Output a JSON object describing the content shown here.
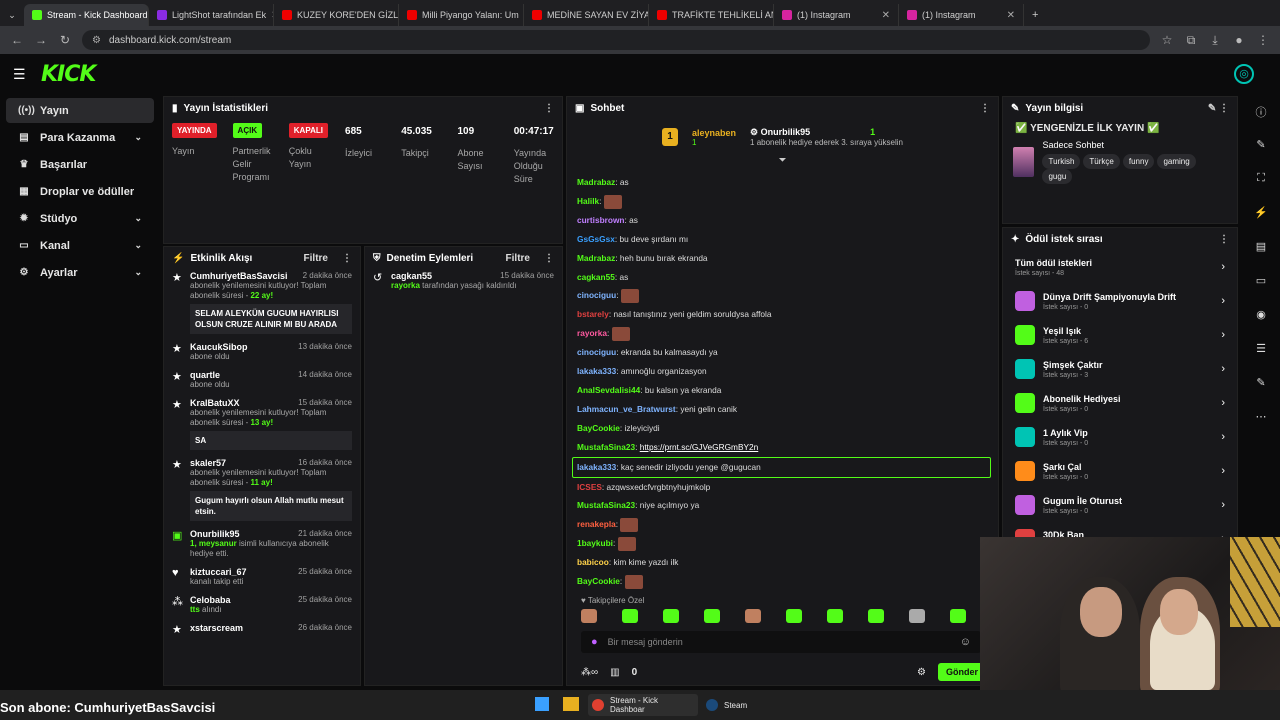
{
  "browser": {
    "tabs": [
      {
        "label": "Stream - Kick Dashboard",
        "color": "#53fc18",
        "active": true
      },
      {
        "label": "LightShot tarafından Ek",
        "color": "#8a2be2"
      },
      {
        "label": "KUZEY KORE'DEN GİZLİ",
        "color": "#e00"
      },
      {
        "label": "Milli Piyango Yalanı: Um",
        "color": "#e00"
      },
      {
        "label": "MEDİNE SAYAN EV ZİYA",
        "color": "#e00"
      },
      {
        "label": "TRAFİKTE TEHLİKELİ AN",
        "color": "#e00"
      },
      {
        "label": "(1) Instagram",
        "color": "#d6249f"
      },
      {
        "label": "(1) Instagram",
        "color": "#d6249f"
      }
    ],
    "url": "dashboard.kick.com/stream"
  },
  "sidebar": {
    "items": [
      {
        "label": "Yayın",
        "icon": "broadcast-icon",
        "selected": true
      },
      {
        "label": "Para Kazanma",
        "icon": "money-icon",
        "chevron": true
      },
      {
        "label": "Başarılar",
        "icon": "trophy-icon"
      },
      {
        "label": "Droplar ve ödüller",
        "icon": "gift-icon"
      },
      {
        "label": "Stüdyo",
        "icon": "gear-icon",
        "chevron": true
      },
      {
        "label": "Kanal",
        "icon": "tv-icon",
        "chevron": true
      },
      {
        "label": "Ayarlar",
        "icon": "settings-icon",
        "chevron": true
      }
    ]
  },
  "stats": {
    "title": "Yayın İstatistikleri",
    "items": [
      {
        "value": "YAYINDA",
        "badge": "red",
        "label": "Yayın"
      },
      {
        "value": "AÇIK",
        "badge": "green",
        "label": "Partnerlik Gelir Programı"
      },
      {
        "value": "KAPALI",
        "badge": "red",
        "label": "Çoklu Yayın"
      },
      {
        "value": "685",
        "label": "İzleyici"
      },
      {
        "value": "45.035",
        "label": "Takipçi"
      },
      {
        "value": "109",
        "label": "Abone Sayısı"
      },
      {
        "value": "00:47:17",
        "label": "Yayında Olduğu Süre"
      }
    ]
  },
  "activity": {
    "title": "Etkinlik Akışı",
    "filter": "Filtre",
    "items": [
      {
        "name": "CumhuriyetBasSavcisi",
        "time": "2 dakika önce",
        "desc": "abonelik yenilemesini kutluyor! Toplam abonelik süresi - ",
        "hl": "22 ay!",
        "msg": "SELAM ALEYKÜM GUGUM HAYIRLISI OLSUN CRUZE ALINIR MI BU ARADA",
        "icon": "star"
      },
      {
        "name": "KaucukSibop",
        "time": "13 dakika önce",
        "desc": "abone oldu",
        "icon": "star"
      },
      {
        "name": "quartle",
        "time": "14 dakika önce",
        "desc": "abone oldu",
        "icon": "star"
      },
      {
        "name": "KralBatuXX",
        "time": "15 dakika önce",
        "desc": "abonelik yenilemesini kutluyor! Toplam abonelik süresi - ",
        "hl": "13 ay!",
        "msg": "SA",
        "icon": "star"
      },
      {
        "name": "skaler57",
        "time": "16 dakika önce",
        "desc": "abonelik yenilemesini kutluyor! Toplam abonelik süresi - ",
        "hl": "11 ay!",
        "msg": "Gugum hayırlı olsun Allah mutlu mesut etsin.",
        "icon": "star"
      },
      {
        "name": "Onurbilik95",
        "time": "21 dakika önce",
        "desc": "isimli kullanıcıya abonelik hediye etti.",
        "pre": "1, meysanur",
        "icon": "gift"
      },
      {
        "name": "kiztuccari_67",
        "time": "25 dakika önce",
        "desc": "kanalı takip etti",
        "icon": "heart"
      },
      {
        "name": "Celobaba",
        "time": "25 dakika önce",
        "desc": "alındı",
        "pre": "tts",
        "icon": "bolt"
      },
      {
        "name": "xstarscream",
        "time": "26 dakika önce",
        "desc": "",
        "icon": "star"
      }
    ]
  },
  "moderation": {
    "title": "Denetim Eylemleri",
    "filter": "Filtre",
    "items": [
      {
        "name": "cagkan55",
        "time": "15 dakika önce",
        "by": "rayorka",
        "desc": " tarafından yasağı kaldırıldı"
      }
    ]
  },
  "chat": {
    "title": "Sohbet",
    "pinned": {
      "gifter": "aleynaben",
      "count": "1",
      "recipient": "Onurbilik95",
      "rcount": "1",
      "note": "1 abonelik hediye ederek 3. sıraya yükselin"
    },
    "messages": [
      {
        "user": "Madrabaz",
        "color": "#53fc18",
        "text": "as"
      },
      {
        "user": "Halilk",
        "color": "#53fc18",
        "text": "",
        "emote": true
      },
      {
        "user": "curtisbrown",
        "color": "#c080ff",
        "text": "as"
      },
      {
        "user": "GsGsGsx",
        "color": "#3aa0ff",
        "text": "bu deve şırdanı mı"
      },
      {
        "user": "Madrabaz",
        "color": "#53fc18",
        "text": "heh bunu bırak ekranda"
      },
      {
        "user": "cagkan55",
        "color": "#53fc18",
        "text": "as"
      },
      {
        "user": "cinociguu",
        "color": "#7fb4ff",
        "text": "",
        "emote": true
      },
      {
        "user": "bstarely",
        "color": "#e04040",
        "text": "nasıl tanıştınız yeni geldim soruldysa affola"
      },
      {
        "user": "rayorka",
        "color": "#ff5aa0",
        "text": "",
        "emote": true
      },
      {
        "user": "cinociguu",
        "color": "#7fb4ff",
        "text": "ekranda bu kalmasaydı ya"
      },
      {
        "user": "lakaka333",
        "color": "#7fb4ff",
        "text": "amınoğlu organizasyon"
      },
      {
        "user": "AnalSevdalisi44",
        "color": "#53fc18",
        "text": "bu kalsın ya ekranda"
      },
      {
        "user": "Lahmacun_ve_Bratwurst",
        "color": "#7fb4ff",
        "text": "yeni gelin canik"
      },
      {
        "user": "BayCookie",
        "color": "#53fc18",
        "text": "izleyiciydi"
      },
      {
        "user": "MustafaSina23",
        "color": "#53fc18",
        "text": "https://prnt.sc/GJVeGRGmBY2n"
      },
      {
        "user": "lakaka333",
        "color": "#7fb4ff",
        "text": "kaç senedir izliyodu yenge @gugucan",
        "highlight": true
      },
      {
        "user": "ICSES",
        "color": "#e04040",
        "text": "azqwsxedcfvrgbtnyhujmkolp"
      },
      {
        "user": "MustafaSina23",
        "color": "#53fc18",
        "text": "niye açılmıyo ya"
      },
      {
        "user": "renakepla",
        "color": "#ff6040",
        "text": "",
        "emote": true
      },
      {
        "user": "1baykubi",
        "color": "#53fc18",
        "text": "",
        "emote": true
      },
      {
        "user": "babicoo",
        "color": "#ffd24a",
        "text": "kim kime yazdı ilk"
      },
      {
        "user": "BayCookie",
        "color": "#53fc18",
        "text": "",
        "emote": true
      }
    ],
    "emote_section": "Takipçilere Özel",
    "input_placeholder": "Bir mesaj gönderin",
    "count": "0",
    "send": "Gönder"
  },
  "streaminfo": {
    "title": "Yayın bilgisi",
    "stream_title": "YENGENİZLE İLK YAYIN",
    "category": "Sadece Sohbet",
    "tags": [
      "Turkish",
      "Türkçe",
      "funny",
      "gaming",
      "gugu"
    ]
  },
  "rewards": {
    "title": "Ödül istek sırası",
    "items": [
      {
        "title": "Tüm ödül istekleri",
        "sub": "İstek sayısı - 48",
        "color": ""
      },
      {
        "title": "Dünya Drift Şampiyonuyla Drift",
        "sub": "İstek sayısı - 0",
        "color": "#c060e0"
      },
      {
        "title": "Yeşil Işık",
        "sub": "İstek sayısı - 6",
        "color": "#53fc18"
      },
      {
        "title": "Şimşek Çaktır",
        "sub": "İstek sayısı - 3",
        "color": "#00c4b4"
      },
      {
        "title": "Abonelik Hediyesi",
        "sub": "İstek sayısı - 0",
        "color": "#53fc18"
      },
      {
        "title": "1 Aylık Vip",
        "sub": "İstek sayısı - 0",
        "color": "#00c4b4"
      },
      {
        "title": "Şarkı Çal",
        "sub": "İstek sayısı - 0",
        "color": "#ff8c1a"
      },
      {
        "title": "Gugum İle Oturust",
        "sub": "İstek sayısı - 0",
        "color": "#c060e0"
      },
      {
        "title": "30Dk Ban",
        "sub": "İstek sayısı - 0",
        "color": "#e04040"
      }
    ]
  },
  "overlay": {
    "last_sub": "Son abone: CumhuriyetBasSavcisi"
  },
  "taskbar": {
    "apps": [
      "Stream - Kick Dashboar",
      "Steam"
    ]
  }
}
